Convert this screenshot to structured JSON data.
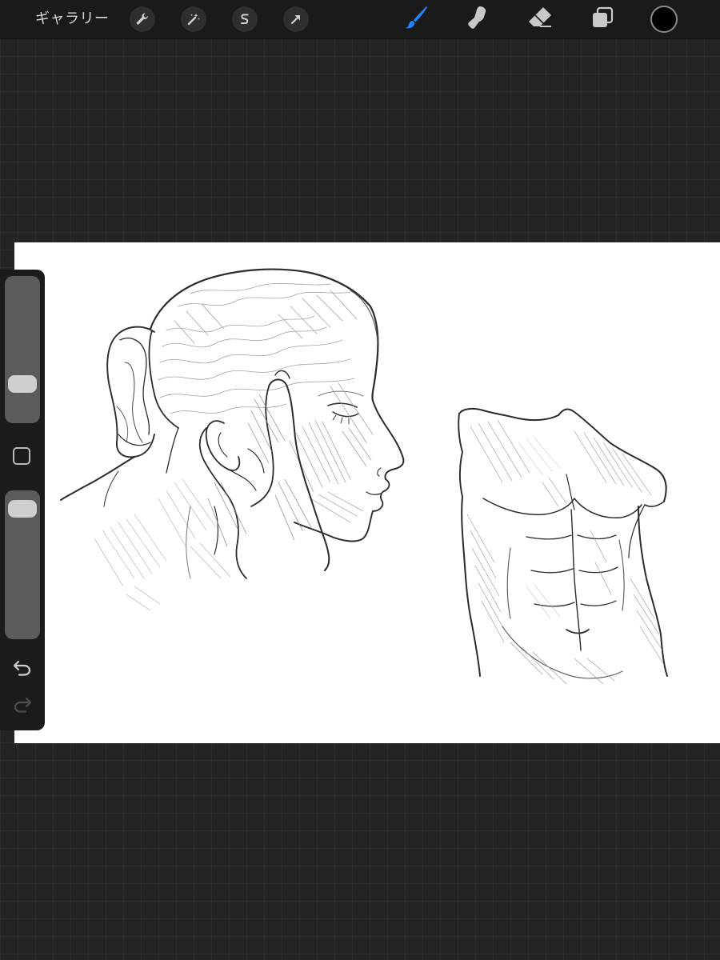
{
  "toolbar": {
    "gallery_label": "ギャラリー",
    "left_tools": [
      {
        "name": "actions",
        "icon": "wrench-icon"
      },
      {
        "name": "adjustments",
        "icon": "magic-wand-icon"
      },
      {
        "name": "selection",
        "icon": "selection-s-icon"
      },
      {
        "name": "transform",
        "icon": "arrow-cursor-icon"
      }
    ],
    "right_tools": [
      {
        "name": "brush",
        "icon": "paintbrush-icon",
        "active": true
      },
      {
        "name": "smudge",
        "icon": "smudge-finger-icon",
        "active": false
      },
      {
        "name": "eraser",
        "icon": "eraser-icon",
        "active": false
      },
      {
        "name": "layers",
        "icon": "layers-icon",
        "active": false
      }
    ],
    "current_color": "#000000",
    "active_color": "#1e84ff",
    "icon_color": "#c8c8c8"
  },
  "sidebar": {
    "brush_size_level": 0.22,
    "brush_opacity_level": 0.95,
    "modify_icon": "square-outline-icon",
    "undo_icon": "undo-arrow-icon",
    "redo_icon": "redo-arrow-icon"
  },
  "canvas": {
    "background": "#ffffff",
    "contents": [
      "head-sketch",
      "torso-sketch"
    ]
  }
}
